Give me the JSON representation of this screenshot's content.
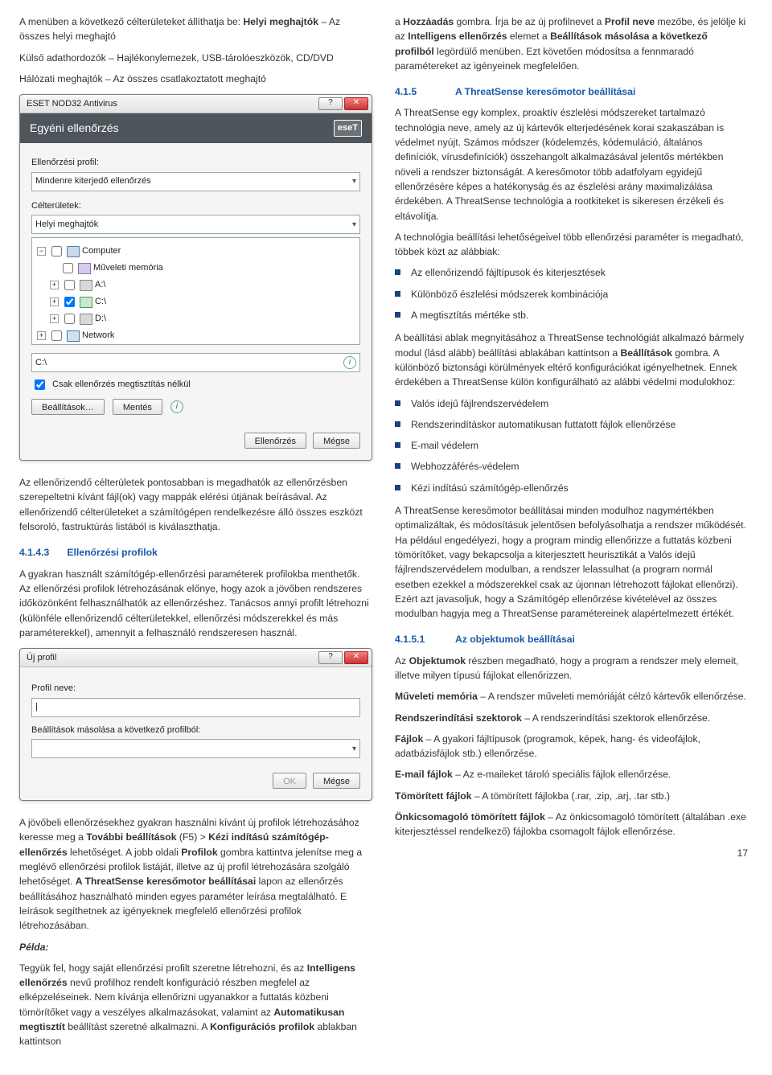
{
  "left": {
    "intro": "A menüben a következő célterületeket állíthatja be: ",
    "intro_b1": "Helyi meghajtók",
    "intro_cont": " – Az összes helyi meghajtó",
    "kulso": "Külső adathordozók – Hajlékonylemezek, USB-tárolóeszközök, CD/DVD",
    "halozati": "Hálózati meghajtók – Az összes csatlakoztatott meghajtó",
    "win1": {
      "title": "ESET NOD32 Antivirus",
      "help": "?",
      "close": "✕",
      "banner": "Egyéni ellenőrzés",
      "eset": "eseT",
      "lbl_profile": "Ellenőrzési profil:",
      "profile": "Mindenre kiterjedő ellenőrzés",
      "lbl_targets": "Célterületek:",
      "target_sel": "Helyi meghajtók",
      "tree": {
        "computer": "Computer",
        "mem": "Műveleti memória",
        "a": "A:\\",
        "c": "C:\\",
        "d": "D:\\",
        "net": "Network"
      },
      "path": "C:\\",
      "chk": "Csak ellenőrzés megtisztítás nélkül",
      "btn_settings": "Beállítások…",
      "btn_save": "Mentés",
      "btn_scan": "Ellenőrzés",
      "btn_cancel": "Mégse"
    },
    "para_targets": "Az ellenőrizendő célterületek pontosabban is megadhatók az ellenőrzésben szerepeltetni kívánt fájl(ok) vagy mappák elérési útjának beírásával. Az ellenőrizendő célterületeket a számítógépen rendelkezésre álló összes eszközt felsoroló, fastruktúrás listából is kiválaszthatja.",
    "head_4143_num": "4.1.4.3",
    "head_4143_txt": "Ellenőrzési profilok",
    "para_profiles": "A gyakran használt számítógép-ellenőrzési paraméterek profilokba menthetők. Az ellenőrzési profilok létrehozásának előnye, hogy azok a jövőben rendszeres időközönként felhasználhatók az ellenőrzéshez. Tanácsos annyi profilt létrehozni (különféle ellenőrizendő célterületekkel, ellenőrzési módszerekkel és más paraméterekkel), amennyit a felhasználó rendszeresen használ.",
    "win2": {
      "title": "Új profil",
      "help": "?",
      "close": "✕",
      "lbl_name": "Profil neve:",
      "name_ph": "|",
      "lbl_copy": "Beállítások másolása a következő profilból:",
      "btn_ok": "OK",
      "btn_cancel": "Mégse"
    },
    "para_future_1": "A jövőbeli ellenőrzésekhez gyakran használni kívánt új profilok létrehozásához keresse meg a ",
    "para_future_b1": "További beállítások",
    "para_future_2": " (F5) > ",
    "para_future_b2": "Kézi indítású számítógép-ellenőrzés",
    "para_future_3": " lehetőséget. A jobb oldali ",
    "para_future_b3": "Profilok",
    "para_future_4": " gombra kattintva jelenítse meg a meglévő ellenőrzési profilok listáját, illetve az új profil létrehozására szolgáló lehetőséget. ",
    "para_future_b4": "A ThreatSense keresőmotor beállításai",
    "para_future_5": " lapon az ellenőrzés beállításához használható minden egyes paraméter leírása megtalálható. E leírások segíthetnek az igényeknek megfelelő ellenőrzési profilok létrehozásában.",
    "pelda_hd": "Példa:",
    "pelda_1": "Tegyük fel, hogy saját ellenőrzési profilt szeretne létrehozni, és az ",
    "pelda_b1": "Intelligens ellenőrzés",
    "pelda_2": " nevű profilhoz rendelt konfiguráció részben megfelel az elképzeléseinek. Nem kívánja ellenőrizni ugyanakkor a futtatás közbeni tömörítőket vagy a veszélyes alkalmazásokat, valamint az ",
    "pelda_b2": "Automatikusan megtisztít",
    "pelda_3": " beállítást szeretné alkalmazni. A ",
    "pelda_b3": "Konfigurációs profilok",
    "pelda_4": " ablakban kattintson"
  },
  "right": {
    "r1_1": "a ",
    "r1_b1": "Hozzáadás",
    "r1_2": " gombra. Írja be az új profilnevet a ",
    "r1_b2": "Profil neve",
    "r1_3": " mezőbe, és jelölje ki az ",
    "r1_b3": "Intelligens ellenőrzés",
    "r1_4": " elemet a ",
    "r1_b4": "Beállítások másolása a következő profilból",
    "r1_5": " legördülő menüben. Ezt követően módosítsa a fennmaradó paramétereket az igényeinek megfelelően.",
    "head_415_num": "4.1.5",
    "head_415_txt": "A ThreatSense keresőmotor beállításai",
    "p_ts1": "A ThreatSense egy komplex, proaktív észlelési módszereket tartalmazó technológia neve, amely az új kártevők elterjedésének korai szakaszában is védelmet nyújt. Számos módszer (kódelemzés, kódemuláció, általános definíciók, vírusdefiníciók) összehangolt alkalmazásával jelentős mértékben növeli a rendszer biztonságát. A keresőmotor több adatfolyam egyidejű ellenőrzésére képes a hatékonyság és az észlelési arány maximalizálása érdekében. A ThreatSense technológia a rootkiteket is sikeresen érzékeli és eltávolítja.",
    "p_ts2": "A technológia beállítási lehetőségeivel több ellenőrzési paraméter is megadható, többek közt az alábbiak:",
    "list1": {
      "i1": "Az ellenőrizendő fájltípusok és kiterjesztések",
      "i2": "Különböző észlelési módszerek kombinációja",
      "i3": "A megtisztítás mértéke stb."
    },
    "p_ts3_1": "A beállítási ablak megnyitásához a ThreatSense technológiát alkalmazó bármely modul (lásd alább) beállítási ablakában kattintson a ",
    "p_ts3_b": "Beállítások",
    "p_ts3_2": " gombra. A különböző biztonsági körülmények eltérő konfigurációkat igényelhetnek. Ennek érdekében a ThreatSense külön konfigurálható az alábbi védelmi modulokhoz:",
    "list2": {
      "i1": "Valós idejű fájlrendszervédelem",
      "i2": "Rendszerindításkor automatikusan futtatott fájlok ellenőrzése",
      "i3": "E-mail védelem",
      "i4": "Webhozzáférés-védelem",
      "i5": "Kézi indítású számítógép-ellenőrzés"
    },
    "p_ts4": "A ThreatSense keresőmotor beállításai minden modulhoz nagymértékben optimalizáltak, és módosításuk jelentősen befolyásolhatja a rendszer működését. Ha például engedélyezi, hogy a program mindig ellenőrizze a futtatás közbeni tömörítőket, vagy bekapcsolja a kiterjesztett heurisztikát a Valós idejű fájlrendszervédelem modulban, a rendszer lelassulhat (a program normál esetben ezekkel a módszerekkel csak az újonnan létrehozott fájlokat ellenőrzi). Ezért azt javasoljuk, hogy a Számítógép ellenőrzése kivételével az összes modulban hagyja meg a ThreatSense paramétereinek alapértelmezett értékét.",
    "head_4151_num": "4.1.5.1",
    "head_4151_txt": "Az objektumok beállításai",
    "p_obj_1": "Az ",
    "p_obj_b": "Objektumok",
    "p_obj_2": " részben megadható, hogy a program a rendszer mely elemeit, illetve milyen típusú fájlokat ellenőrizzen.",
    "it_mem_b": "Műveleti memória",
    "it_mem_t": " – A rendszer műveleti memóriáját célzó kártevők ellenőrzése.",
    "it_boot_b": "Rendszerindítási szektorok",
    "it_boot_t": " – A rendszerindítási szektorok ellenőrzése.",
    "it_files_b": "Fájlok",
    "it_files_t": " – A gyakori fájltípusok (programok, képek, hang- és videofájlok, adatbázisfájlok stb.) ellenőrzése.",
    "it_email_b": "E-mail fájlok",
    "it_email_t": " – Az e-maileket tároló speciális fájlok ellenőrzése.",
    "it_arch_b": "Tömörített fájlok",
    "it_arch_t": " – A tömörített fájlokba (.rar, .zip, .arj, .tar stb.)",
    "it_sfx_b": "Önkicsomagoló tömörített fájlok",
    "it_sfx_t": " – Az önkicsomagoló tömörített (általában .exe kiterjesztéssel rendelkező) fájlokba csomagolt fájlok ellenőrzése."
  },
  "pagenum": "17"
}
